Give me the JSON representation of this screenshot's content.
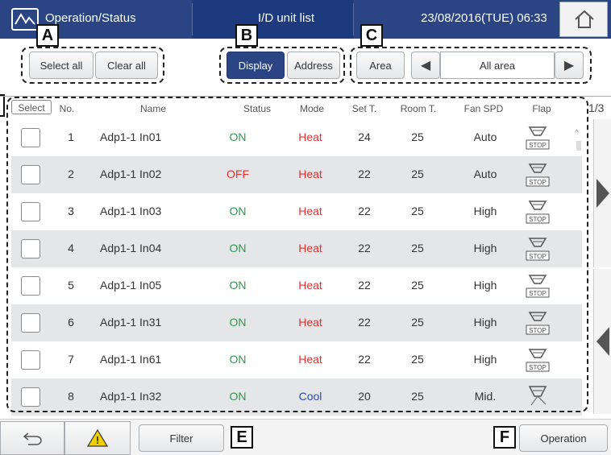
{
  "header": {
    "title": "Operation/Status",
    "center_title": "I/D unit list",
    "datetime": "23/08/2016(TUE) 06:33"
  },
  "labels": {
    "a": "A",
    "b": "B",
    "c": "C",
    "e": "E",
    "f": "F"
  },
  "toolbar": {
    "select_all": "Select all",
    "clear_all": "Clear all",
    "display": "Display",
    "address": "Address",
    "area": "Area",
    "area_value": "All area"
  },
  "table": {
    "headers": [
      "Select",
      "No.",
      "Name",
      "Status",
      "Mode",
      "Set T.",
      "Room T.",
      "Fan SPD",
      "Flap"
    ],
    "page": "1/3",
    "rows": [
      {
        "no": "1",
        "name": "Adp1-1 In01",
        "status": "ON",
        "mode": "Heat",
        "set_t": "24",
        "room_t": "25",
        "fan": "Auto",
        "flap": "STOP"
      },
      {
        "no": "2",
        "name": "Adp1-1 In02",
        "status": "OFF",
        "mode": "Heat",
        "set_t": "22",
        "room_t": "25",
        "fan": "Auto",
        "flap": "STOP"
      },
      {
        "no": "3",
        "name": "Adp1-1 In03",
        "status": "ON",
        "mode": "Heat",
        "set_t": "22",
        "room_t": "25",
        "fan": "High",
        "flap": "STOP"
      },
      {
        "no": "4",
        "name": "Adp1-1 In04",
        "status": "ON",
        "mode": "Heat",
        "set_t": "22",
        "room_t": "25",
        "fan": "High",
        "flap": "STOP"
      },
      {
        "no": "5",
        "name": "Adp1-1 In05",
        "status": "ON",
        "mode": "Heat",
        "set_t": "22",
        "room_t": "25",
        "fan": "High",
        "flap": "STOP"
      },
      {
        "no": "6",
        "name": "Adp1-1 In31",
        "status": "ON",
        "mode": "Heat",
        "set_t": "22",
        "room_t": "25",
        "fan": "High",
        "flap": "STOP"
      },
      {
        "no": "7",
        "name": "Adp1-1 In61",
        "status": "ON",
        "mode": "Heat",
        "set_t": "22",
        "room_t": "25",
        "fan": "High",
        "flap": "STOP"
      },
      {
        "no": "8",
        "name": "Adp1-1 In32",
        "status": "ON",
        "mode": "Cool",
        "set_t": "20",
        "room_t": "25",
        "fan": "Mid.",
        "flap": ""
      }
    ]
  },
  "footer": {
    "filter": "Filter",
    "operation": "Operation"
  },
  "icons": {
    "logo": "monitor-pulse-icon",
    "home": "home-icon",
    "back": "back-arrow-icon",
    "warning": "warning-icon",
    "flap": "flap-stop-icon"
  },
  "colors": {
    "header_bg": "#2a4484",
    "on": "#2e9a4e",
    "off": "#e03030",
    "heat": "#e03030",
    "cool": "#2a4aa8",
    "selected_tab": "#2a4484"
  }
}
